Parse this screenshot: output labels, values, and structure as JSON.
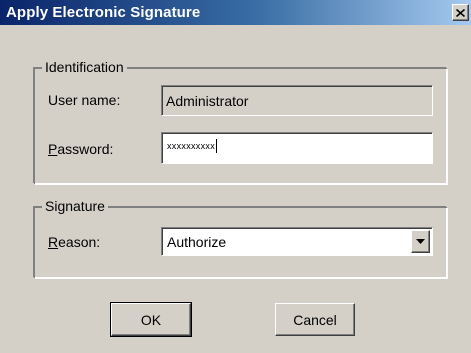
{
  "window": {
    "title": "Apply Electronic Signature",
    "close_icon": "close-icon"
  },
  "identification": {
    "legend": "Identification",
    "username_label": "User name:",
    "username_value": "Administrator",
    "password_label_first": "P",
    "password_label_rest": "assword:",
    "password_value": "xxxxxxxxxx"
  },
  "signature": {
    "legend": "Signature",
    "reason_label_first": "R",
    "reason_label_rest": "eason:",
    "reason_value": "Authorize",
    "dropdown_icon": "chevron-down-icon"
  },
  "buttons": {
    "ok_label": "OK",
    "cancel_label": "Cancel"
  },
  "colors": {
    "titlebar_start": "#0a246a",
    "titlebar_end": "#a6caf0",
    "dialog_background": "#d4d0c8"
  }
}
